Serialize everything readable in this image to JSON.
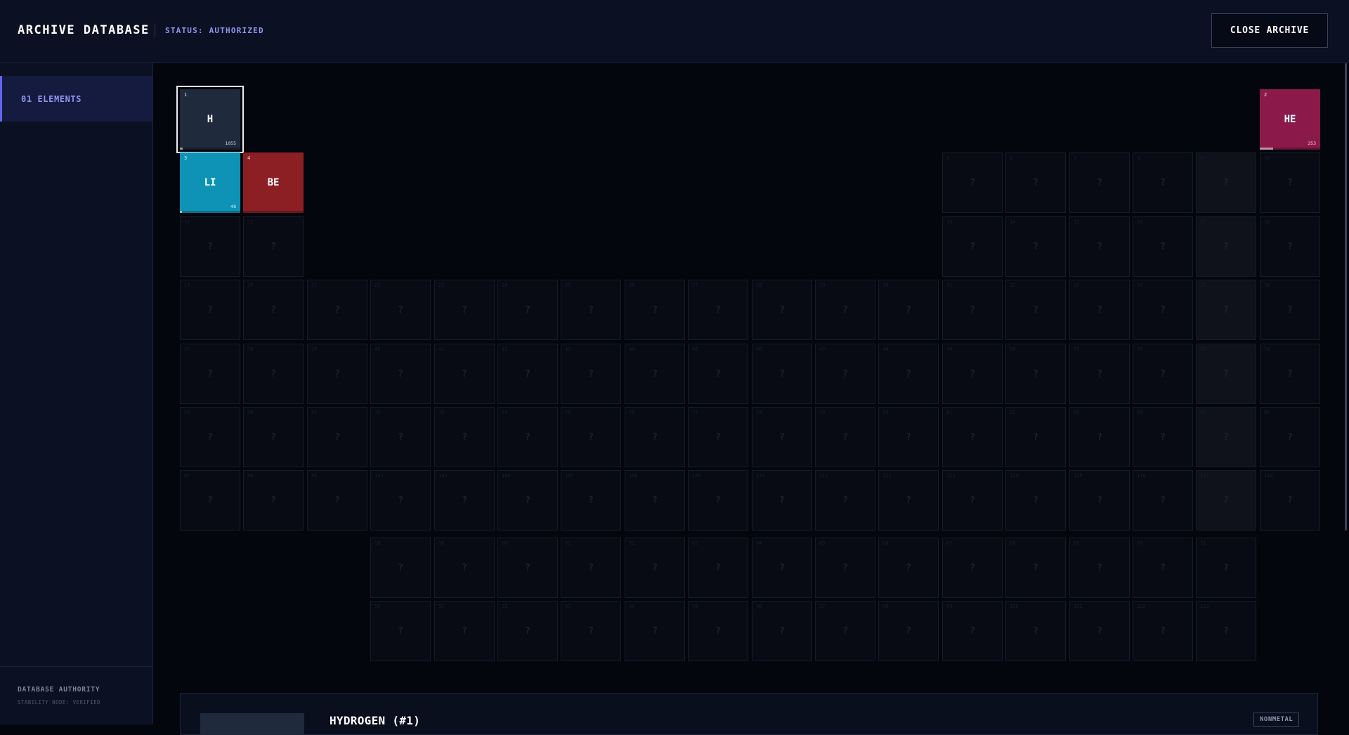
{
  "header": {
    "title": "ARCHIVE DATABASE",
    "status": "STATUS: AUTHORIZED",
    "close_label": "CLOSE ARCHIVE"
  },
  "sidebar": {
    "items": [
      {
        "label": "01 ELEMENTS",
        "active": true
      }
    ],
    "footer_title": "DATABASE AUTHORITY",
    "footer_subtitle": "STABILITY NODE: VERIFIED"
  },
  "colors": {
    "accent": "#6366f1",
    "hydrogen": "#1f2a3c",
    "helium": "#8b1a4a",
    "lithium": "#0e93b7",
    "beryllium": "#8c1f24"
  },
  "known_elements": [
    {
      "number": "1",
      "symbol": "H",
      "value": "1055",
      "stability": 0.05,
      "color": "#1f2a3c",
      "selected": true
    },
    {
      "number": "2",
      "symbol": "HE",
      "value": "253",
      "stability": 0.22,
      "color": "#8b1a4a",
      "selected": false
    },
    {
      "number": "3",
      "symbol": "LI",
      "value": "48",
      "stability": 0.04,
      "color": "#0e93b7",
      "selected": false
    },
    {
      "number": "4",
      "symbol": "BE",
      "value": "",
      "stability": 0.0,
      "color": "#8c1f24",
      "selected": false
    }
  ],
  "unknown_symbol": "?",
  "detail": {
    "title": "HYDROGEN (#1)",
    "badge": "NONMETAL"
  }
}
